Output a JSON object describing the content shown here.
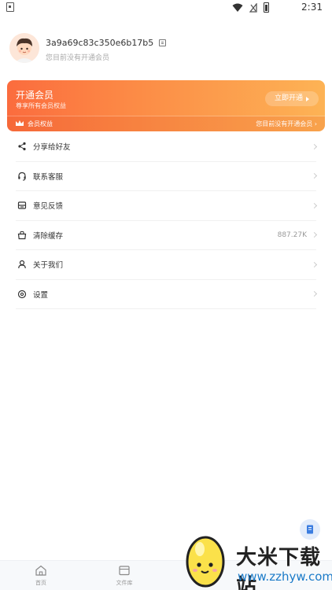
{
  "status_bar": {
    "time": "2:31"
  },
  "profile": {
    "user_id": "3a9a69c83c350e6b17b5",
    "subtitle": "您目前没有开通会员"
  },
  "vip_card": {
    "title": "开通会员",
    "subtitle": "尊享所有会员权益",
    "button_label": "立即开通",
    "rights_label": "会员权益",
    "status_text": "您目前没有开通会员 ›",
    "gradient_start": "#fb6c3e",
    "gradient_end": "#fdb355"
  },
  "menu": {
    "items": [
      {
        "label": "分享给好友",
        "icon": "share-icon"
      },
      {
        "label": "联系客服",
        "icon": "headset-icon"
      },
      {
        "label": "意见反馈",
        "icon": "feedback-icon"
      },
      {
        "label": "清除缓存",
        "icon": "clear-cache-icon",
        "value": "887.27K"
      },
      {
        "label": "关于我们",
        "icon": "user-icon"
      },
      {
        "label": "设置",
        "icon": "settings-icon"
      }
    ]
  },
  "tabbar": {
    "tabs": [
      {
        "label": "首页",
        "icon": "home-icon"
      },
      {
        "label": "文件库",
        "icon": "file-library-icon"
      }
    ]
  },
  "watermark": {
    "title": "大米下载站",
    "url": "www.zzhyw.com"
  }
}
